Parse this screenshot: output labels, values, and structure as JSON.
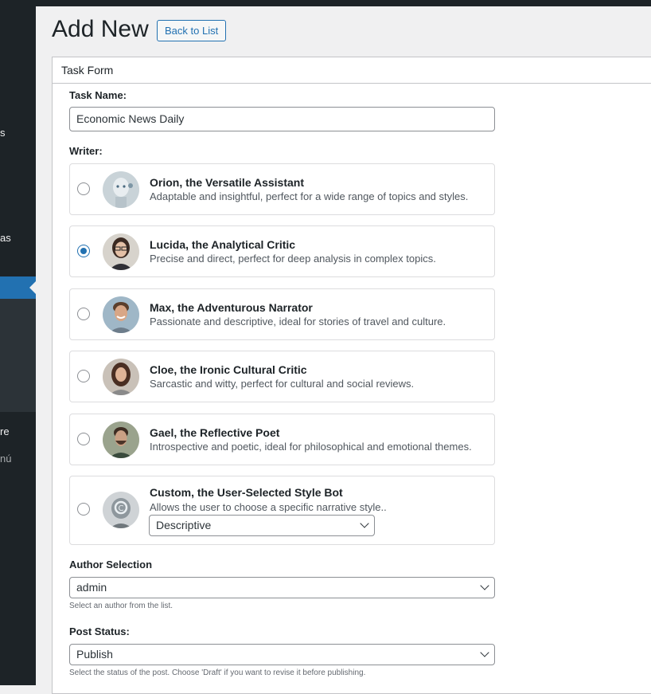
{
  "sidebar": {
    "fragments": [
      "s",
      "as",
      "re",
      "nú"
    ]
  },
  "header": {
    "title": "Add New",
    "back_button": "Back to List"
  },
  "panel": {
    "title": "Task Form"
  },
  "form": {
    "task_name_label": "Task Name:",
    "task_name_value": "Economic News Daily",
    "writer_label": "Writer:",
    "writers": [
      {
        "name": "Orion, the Versatile Assistant",
        "desc": "Adaptable and insightful, perfect for a wide range of topics and styles.",
        "selected": false,
        "avatar": "robot-avatar"
      },
      {
        "name": "Lucida, the Analytical Critic",
        "desc": "Precise and direct, perfect for deep analysis in complex topics.",
        "selected": true,
        "avatar": "woman-glasses-avatar"
      },
      {
        "name": "Max, the Adventurous Narrator",
        "desc": "Passionate and descriptive, ideal for stories of travel and culture.",
        "selected": false,
        "avatar": "smiling-man-avatar"
      },
      {
        "name": "Cloe, the Ironic Cultural Critic",
        "desc": "Sarcastic and witty, perfect for cultural and social reviews.",
        "selected": false,
        "avatar": "woman-avatar"
      },
      {
        "name": "Gael, the Reflective Poet",
        "desc": "Introspective and poetic, ideal for philosophical and emotional themes.",
        "selected": false,
        "avatar": "bearded-man-avatar"
      },
      {
        "name": "Custom, the User-Selected Style Bot",
        "desc": "Allows the user to choose a specific narrative style..",
        "selected": false,
        "avatar": "custom-robot-avatar",
        "style_select": "Descriptive"
      }
    ],
    "author_label": "Author Selection",
    "author_value": "admin",
    "author_hint": "Select an author from the list.",
    "status_label": "Post Status:",
    "status_value": "Publish",
    "status_hint": "Select the status of the post. Choose 'Draft' if you want to revise it before publishing."
  },
  "colors": {
    "accent": "#2271b1",
    "sidebar": "#1d2327",
    "background": "#f0f0f1"
  }
}
